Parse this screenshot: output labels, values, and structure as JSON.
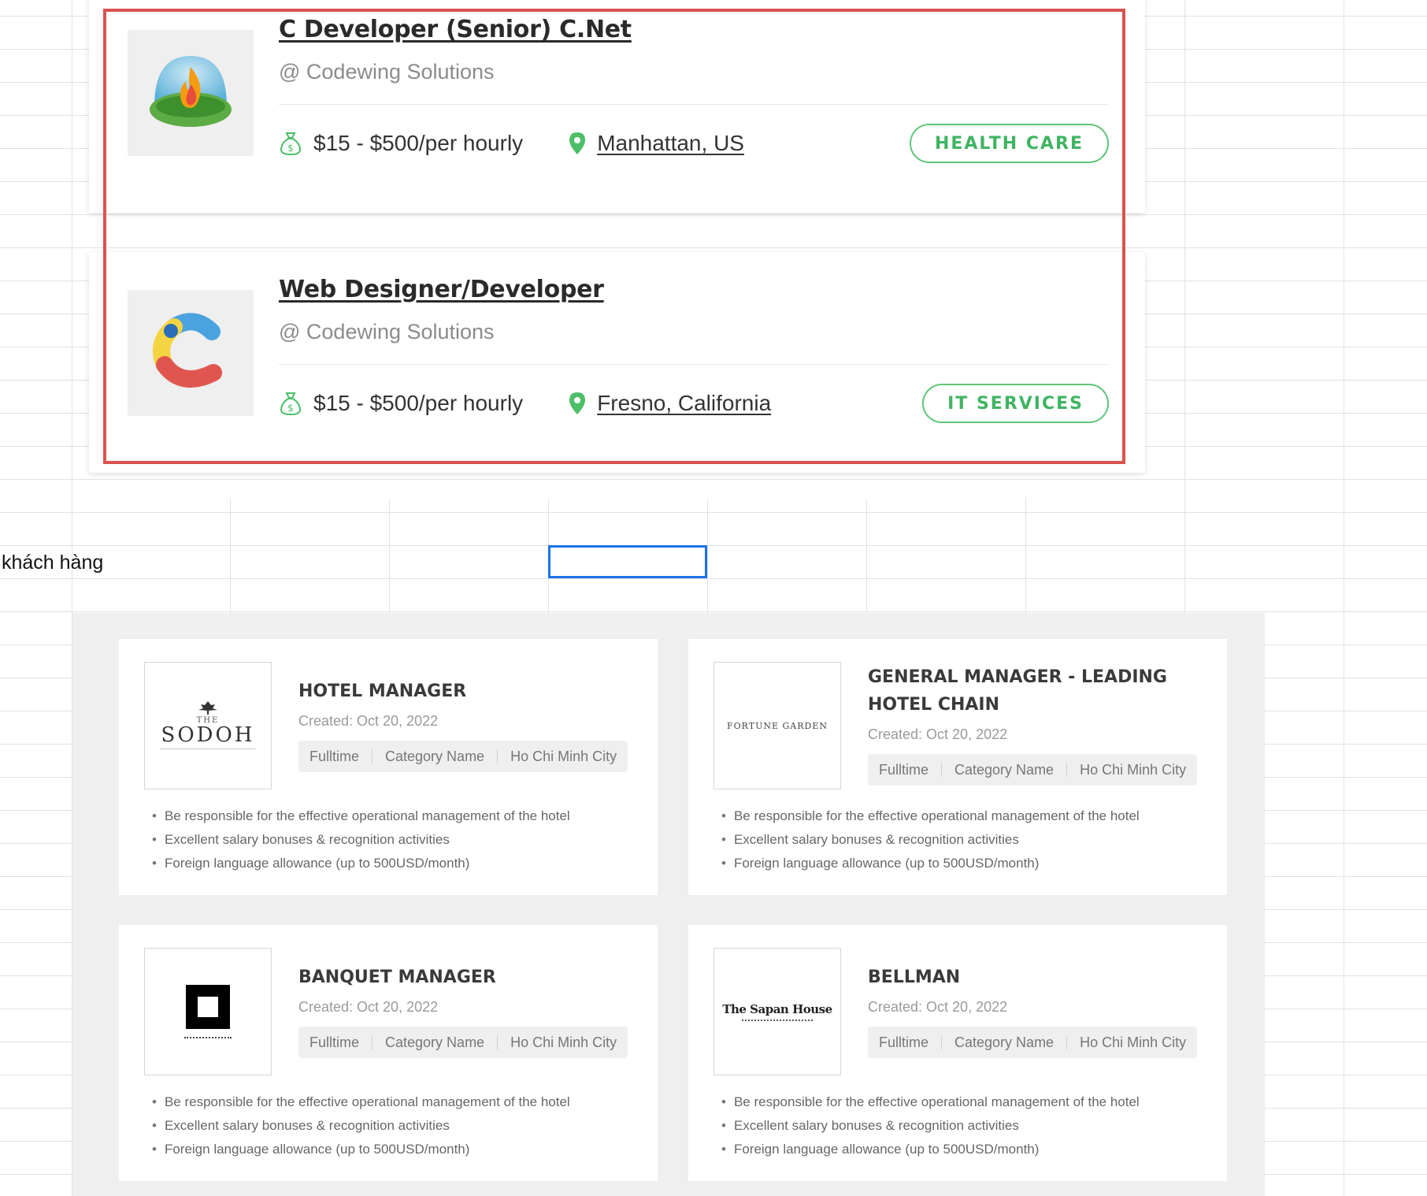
{
  "job_cards": [
    {
      "title": "C Developer (Senior) C.Net",
      "company": "@ Codewing Solutions",
      "salary": "$15 - $500/per hourly",
      "location": "Manhattan, US",
      "tag": "HEALTH CARE"
    },
    {
      "title": "Web Designer/Developer",
      "company": "@ Codewing Solutions",
      "salary": "$15 - $500/per hourly",
      "location": "Fresno, California",
      "tag": "IT SERVICES"
    }
  ],
  "sheet": {
    "cell_label": "khách hàng"
  },
  "listings": [
    {
      "title": "HOTEL MANAGER",
      "logo_text": "SODOH",
      "logo_sub": "THE",
      "created": "Created: Oct 20, 2022",
      "tags": [
        "Fulltime",
        "Category Name",
        "Ho Chi Minh City"
      ],
      "bullets": [
        "Be responsible for the effective operational management of the hotel",
        "Excellent salary bonuses & recognition activities",
        "Foreign language allowance (up to 500USD/month)"
      ]
    },
    {
      "title": "GENERAL MANAGER - LEADING HOTEL CHAIN",
      "logo_text": "FORTUNE GARDEN",
      "created": "Created: Oct 20, 2022",
      "tags": [
        "Fulltime",
        "Category Name",
        "Ho Chi Minh City"
      ],
      "bullets": [
        "Be responsible for the effective operational management of the hotel",
        "Excellent salary bonuses & recognition activities",
        "Foreign language allowance (up to 500USD/month)"
      ]
    },
    {
      "title": "BANQUET MANAGER",
      "created": "Created: Oct 20, 2022",
      "tags": [
        "Fulltime",
        "Category Name",
        "Ho Chi Minh City"
      ],
      "bullets": [
        "Be responsible for the effective operational management of the hotel",
        "Excellent salary bonuses & recognition activities",
        "Foreign language allowance (up to 500USD/month)"
      ]
    },
    {
      "title": "BELLMAN",
      "logo_text": "The Sapan House",
      "created": "Created: Oct 20, 2022",
      "tags": [
        "Fulltime",
        "Category Name",
        "Ho Chi Minh City"
      ],
      "bullets": [
        "Be responsible for the effective operational management of the hotel",
        "Excellent salary bonuses & recognition activities",
        "Foreign language allowance (up to 500USD/month)"
      ]
    }
  ],
  "colors": {
    "accent_green": "#3fb462",
    "highlight_red": "#d9534f",
    "selection_blue": "#1a73e8"
  },
  "icons": [
    "money-bag-icon",
    "location-pin-icon",
    "campfire-logo-icon",
    "c-letter-logo-icon"
  ]
}
